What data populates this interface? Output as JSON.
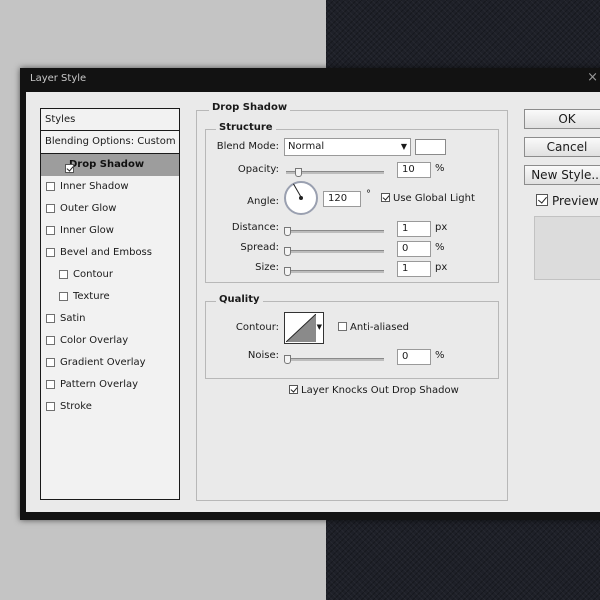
{
  "window": {
    "title": "Layer Style"
  },
  "styles_panel": {
    "header": "Styles",
    "blending_options": "Blending Options: Custom",
    "items": [
      {
        "label": "Drop Shadow",
        "checked": true,
        "selected": true,
        "indent": false
      },
      {
        "label": "Inner Shadow",
        "checked": false,
        "selected": false,
        "indent": false
      },
      {
        "label": "Outer Glow",
        "checked": false,
        "selected": false,
        "indent": false
      },
      {
        "label": "Inner Glow",
        "checked": false,
        "selected": false,
        "indent": false
      },
      {
        "label": "Bevel and Emboss",
        "checked": false,
        "selected": false,
        "indent": false
      },
      {
        "label": "Contour",
        "checked": false,
        "selected": false,
        "indent": true
      },
      {
        "label": "Texture",
        "checked": false,
        "selected": false,
        "indent": true
      },
      {
        "label": "Satin",
        "checked": false,
        "selected": false,
        "indent": false
      },
      {
        "label": "Color Overlay",
        "checked": false,
        "selected": false,
        "indent": false
      },
      {
        "label": "Gradient Overlay",
        "checked": false,
        "selected": false,
        "indent": false
      },
      {
        "label": "Pattern Overlay",
        "checked": false,
        "selected": false,
        "indent": false
      },
      {
        "label": "Stroke",
        "checked": false,
        "selected": false,
        "indent": false
      }
    ]
  },
  "drop_shadow": {
    "title": "Drop Shadow",
    "structure": {
      "title": "Structure",
      "blend_mode_label": "Blend Mode:",
      "blend_mode_value": "Normal",
      "shadow_color": "#ffffff",
      "opacity_label": "Opacity:",
      "opacity_value": "10",
      "opacity_unit": "%",
      "angle_label": "Angle:",
      "angle_value": "120",
      "angle_unit": "°",
      "use_global_light_label": "Use Global Light",
      "use_global_light": true,
      "distance_label": "Distance:",
      "distance_value": "1",
      "distance_unit": "px",
      "spread_label": "Spread:",
      "spread_value": "0",
      "spread_unit": "%",
      "size_label": "Size:",
      "size_value": "1",
      "size_unit": "px"
    },
    "quality": {
      "title": "Quality",
      "contour_label": "Contour:",
      "anti_aliased_label": "Anti-aliased",
      "anti_aliased": false,
      "noise_label": "Noise:",
      "noise_value": "0",
      "noise_unit": "%"
    },
    "knockout_label": "Layer Knocks Out Drop Shadow",
    "knockout": true
  },
  "buttons": {
    "ok": "OK",
    "cancel": "Cancel",
    "new_style": "New Style...",
    "preview_label": "Preview",
    "preview": true
  }
}
